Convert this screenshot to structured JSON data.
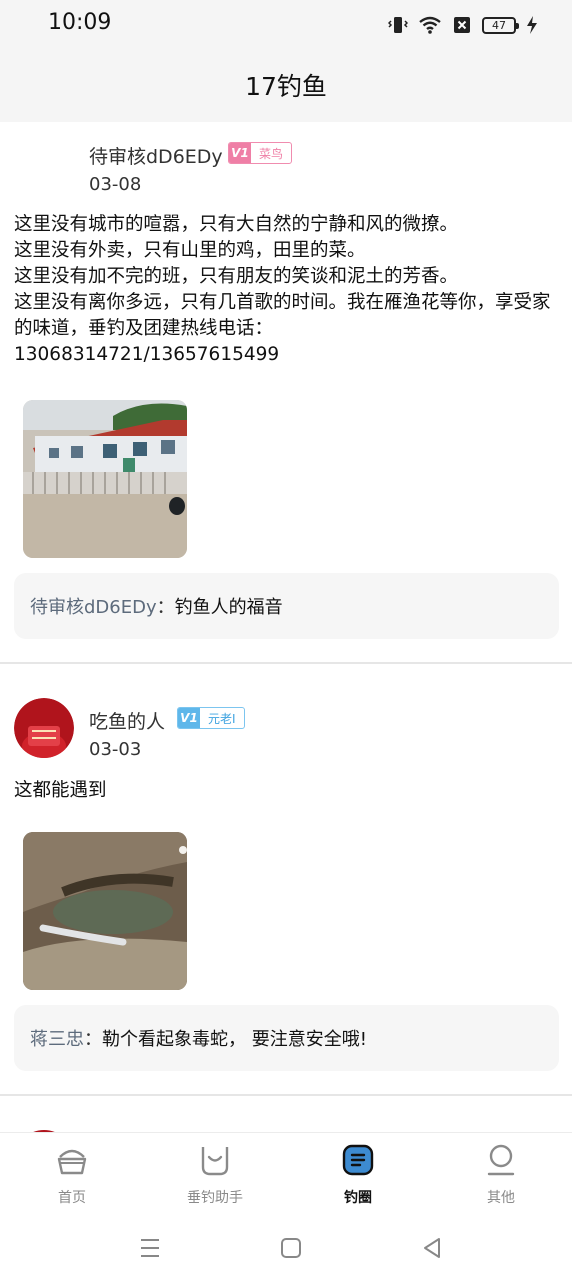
{
  "status_bar": {
    "time": "10:09",
    "battery": "47"
  },
  "header": {
    "title": "17钓鱼"
  },
  "posts": [
    {
      "username": "待审核dD6EDy",
      "badge": {
        "icon": "V1",
        "label": "菜鸟",
        "color": "#ef7fa6"
      },
      "date": "03-08",
      "text": "这里没有城市的喧嚣，只有大自然的宁静和风的微撩。\n这里没有外卖，只有山里的鸡，田里的菜。\n这里没有加不完的班，只有朋友的笑谈和泥土的芳香。\n这里没有离你多远，只有几首歌的时间。我在雁渔花等你，享受家的味道，垂钓及团建热线电话：\n13068314721/13657615499",
      "comment": {
        "author": "待审核dD6EDy",
        "sep": "：",
        "text": "钓鱼人的福音"
      }
    },
    {
      "username": "吃鱼的人",
      "badge": {
        "icon": "V1",
        "label": "元老Ⅰ",
        "color": "#3ea3e0"
      },
      "date": "03-03",
      "text": "这都能遇到",
      "comment": {
        "author": "蒋三忠",
        "sep": "：",
        "text": "勒个看起象毒蛇， 要注意安全哦!"
      }
    }
  ],
  "bottom_nav": [
    {
      "label": "首页",
      "icon": "home-icon",
      "active": false
    },
    {
      "label": "垂钓助手",
      "icon": "assistant-icon",
      "active": false
    },
    {
      "label": "钓圈",
      "icon": "circle-icon",
      "active": true
    },
    {
      "label": "其他",
      "icon": "profile-icon",
      "active": false
    }
  ],
  "colors": {
    "accent": "#3d8bd1",
    "background": "#f5f5f5"
  }
}
